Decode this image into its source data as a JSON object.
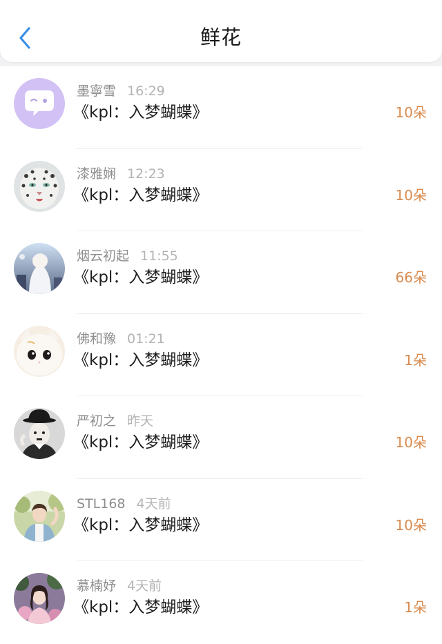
{
  "header": {
    "title": "鲜花",
    "back_icon": "chevron-left-icon",
    "accent_color": "#3a8ee6"
  },
  "rows": [
    {
      "name": "墨寧雪",
      "time": "16:29",
      "content": "《kpl：入梦蝴蝶》",
      "amount": "10朵",
      "avatar": "chat-bubble-avatar"
    },
    {
      "name": "漆雅娴",
      "time": "12:23",
      "content": "《kpl：入梦蝴蝶》",
      "amount": "10朵",
      "avatar": "snow-leopard-avatar"
    },
    {
      "name": "烟云初起",
      "time": "11:55",
      "content": "《kpl：入梦蝴蝶》",
      "amount": "66朵",
      "avatar": "anime-girl-avatar"
    },
    {
      "name": "佛和豫",
      "time": "01:21",
      "content": "《kpl：入梦蝴蝶》",
      "amount": "1朵",
      "avatar": "white-cat-avatar"
    },
    {
      "name": "严初之",
      "time": "昨天",
      "content": "《kpl：入梦蝴蝶》",
      "amount": "10朵",
      "avatar": "bowler-hat-man-avatar"
    },
    {
      "name": "STL168",
      "time": "4天前",
      "content": "《kpl：入梦蝴蝶》",
      "amount": "10朵",
      "avatar": "boy-photo-avatar"
    },
    {
      "name": "慕楠妤",
      "time": "4天前",
      "content": "《kpl：入梦蝴蝶》",
      "amount": "1朵",
      "avatar": "girl-flowers-avatar"
    }
  ],
  "colors": {
    "amount": "#d98b4e",
    "meta": "#9a9a9a",
    "background": "#f2f2f4"
  }
}
